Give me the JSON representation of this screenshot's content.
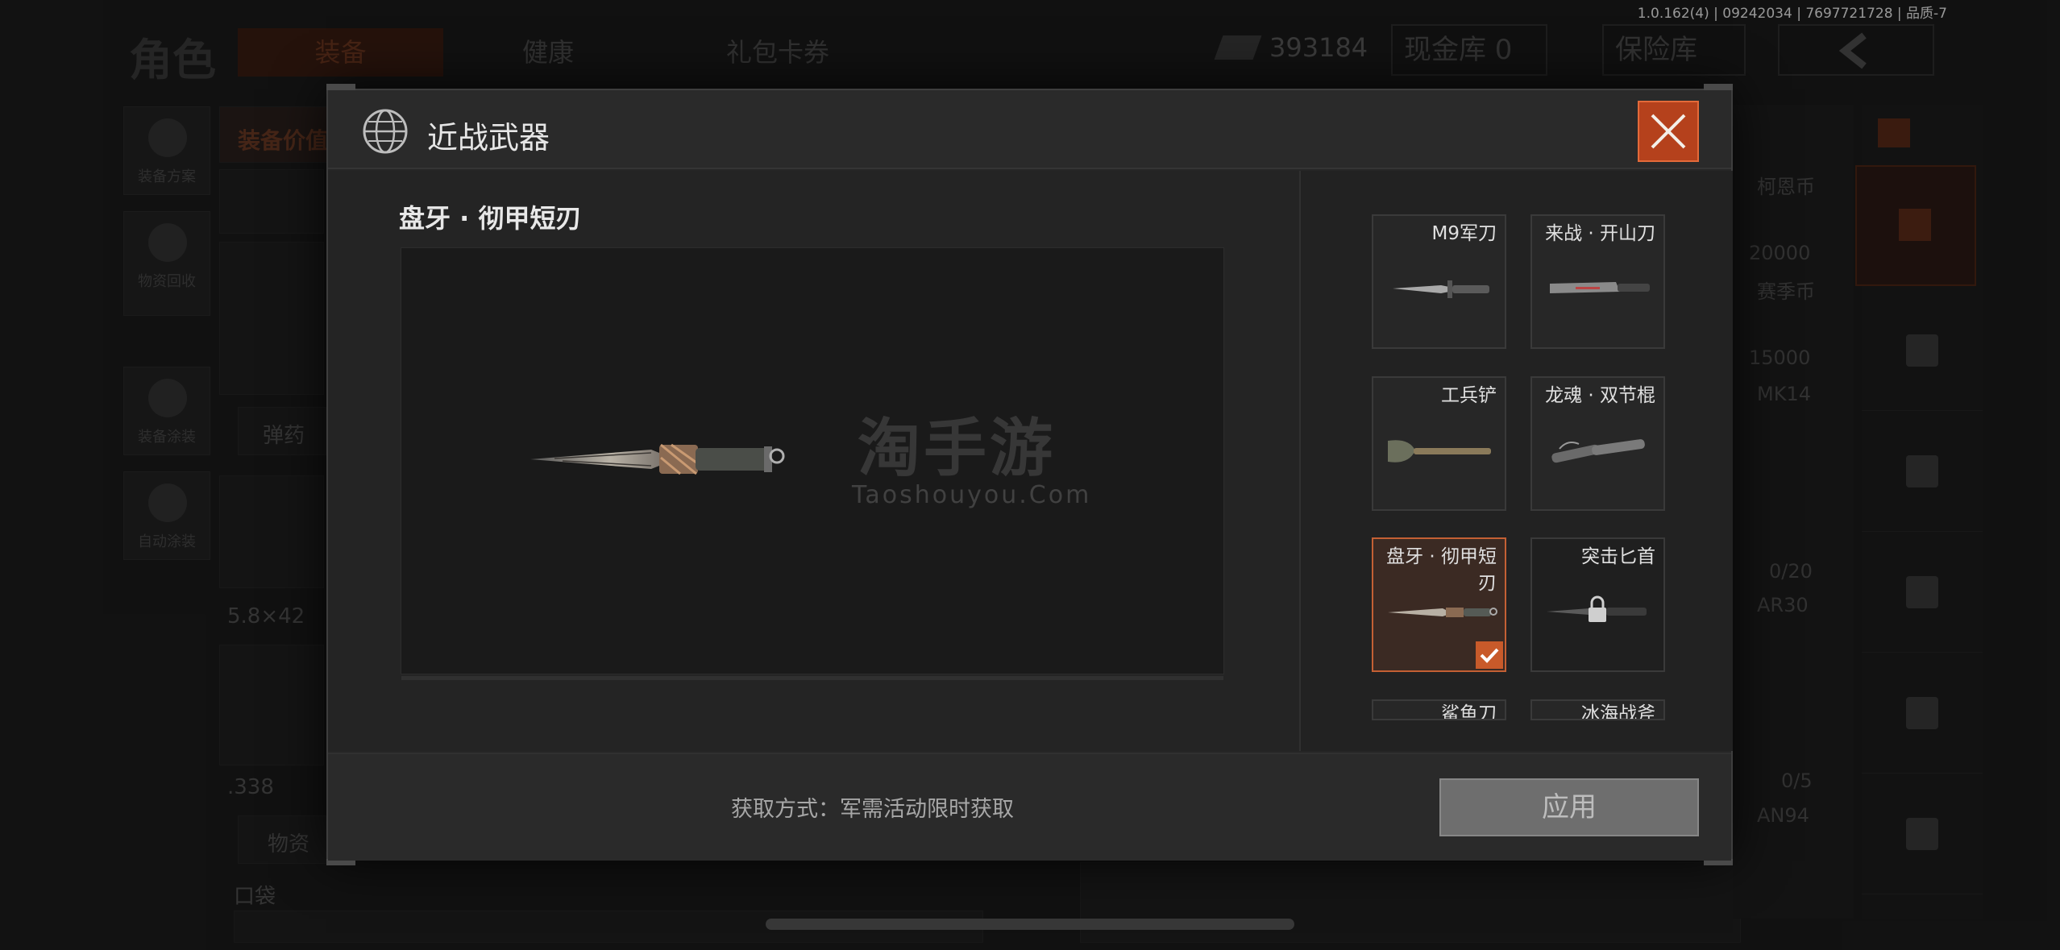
{
  "status_bar": {
    "version_text": "1.0.162(4) | 09242034 | 7697721728 | 品质-7"
  },
  "background": {
    "title": "角色",
    "tabs": [
      {
        "label": "装备"
      },
      {
        "label": "健康"
      },
      {
        "label": "礼包卡券"
      }
    ],
    "currency_amount": "393184",
    "cash_box_label": "现金库 0",
    "vault_label": "保险库",
    "equipment_value_label": "装备价值",
    "side_buttons": [
      {
        "label": "装备方案"
      },
      {
        "label": "物资回收"
      },
      {
        "label": "装备涂装"
      },
      {
        "label": "自动涂装"
      }
    ],
    "ammo_button": "弹药",
    "supplies_button": "物资",
    "calibers": [
      "5.8×42",
      ".338"
    ],
    "pocket_label": "口袋",
    "right_items": [
      {
        "name": "柯恩币",
        "value": "20000"
      },
      {
        "name": "赛季币",
        "value": "15000"
      }
    ],
    "right_weapon_labels": [
      "MK14",
      "AR30",
      "AN94"
    ],
    "ammo_counts": [
      "0/20",
      "0/5"
    ]
  },
  "modal": {
    "title": "近战武器",
    "selected_weapon_name": "盘牙 · 彻甲短刃",
    "watermark": {
      "cn": "淘手游",
      "en": "Taoshouyou.Com"
    },
    "weapons": [
      {
        "name": "M9军刀",
        "state": "normal"
      },
      {
        "name": "来战 · 开山刀",
        "state": "normal"
      },
      {
        "name": "工兵铲",
        "state": "normal"
      },
      {
        "name": "龙魂 · 双节棍",
        "state": "normal"
      },
      {
        "name": "盘牙 · 彻甲短刃",
        "state": "selected"
      },
      {
        "name": "突击匕首",
        "state": "locked"
      },
      {
        "name": "鲨鱼刀",
        "state": "partial"
      },
      {
        "name": "冰海战斧",
        "state": "partial"
      }
    ],
    "acquire_text": "获取方式：军需活动限时获取",
    "apply_label": "应用",
    "colors": {
      "accent": "#c85a2a",
      "close_bg": "#b5411c"
    }
  }
}
